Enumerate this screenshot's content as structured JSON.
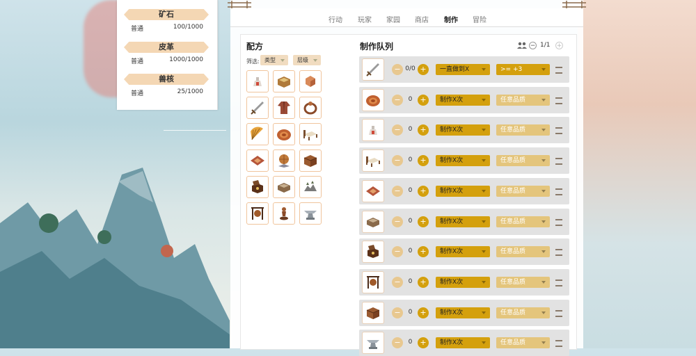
{
  "resources": [
    {
      "name": "矿石",
      "quality": "普通",
      "amount": "100/1000"
    },
    {
      "name": "皮革",
      "quality": "普通",
      "amount": "1000/1000"
    },
    {
      "name": "兽核",
      "quality": "普通",
      "amount": "25/1000"
    }
  ],
  "nav": [
    "行动",
    "玩家",
    "家园",
    "商店",
    "制作",
    "冒险"
  ],
  "nav_active": "制作",
  "recipes": {
    "title": "配方",
    "filter_label": "筛选:",
    "filter_type": "类型",
    "filter_level": "层级",
    "items": [
      "potion-icon",
      "chest-icon",
      "box-icon",
      "sword-icon",
      "robe-icon",
      "ring-icon",
      "fan-icon",
      "disc-icon",
      "bed-icon",
      "rug-icon",
      "globe-icon",
      "crate-icon",
      "jewel-box-icon",
      "planter-icon",
      "rock-icon",
      "gong-icon",
      "statue-icon",
      "anvil-icon"
    ]
  },
  "queue": {
    "title": "制作队列",
    "page": "1/1",
    "rows": [
      {
        "icon": "sword-icon",
        "count": "0/0",
        "mode": "一直做到X",
        "quality": ">= +3",
        "quality_strong": true
      },
      {
        "icon": "disc-icon",
        "count": "0",
        "mode": "制作X次",
        "quality": "任意品质"
      },
      {
        "icon": "potion-icon",
        "count": "0",
        "mode": "制作X次",
        "quality": "任意品质"
      },
      {
        "icon": "bed-icon",
        "count": "0",
        "mode": "制作X次",
        "quality": "任意品质"
      },
      {
        "icon": "rug-icon",
        "count": "0",
        "mode": "制作X次",
        "quality": "任意品质"
      },
      {
        "icon": "planter-icon",
        "count": "0",
        "mode": "制作X次",
        "quality": "任意品质"
      },
      {
        "icon": "jewel-box-icon",
        "count": "0",
        "mode": "制作X次",
        "quality": "任意品质"
      },
      {
        "icon": "gong-icon",
        "count": "0",
        "mode": "制作X次",
        "quality": "任意品质"
      },
      {
        "icon": "crate-icon",
        "count": "0",
        "mode": "制作X次",
        "quality": "任意品质"
      },
      {
        "icon": "anvil-icon",
        "count": "0",
        "mode": "制作X次",
        "quality": "任意品质"
      }
    ]
  }
}
